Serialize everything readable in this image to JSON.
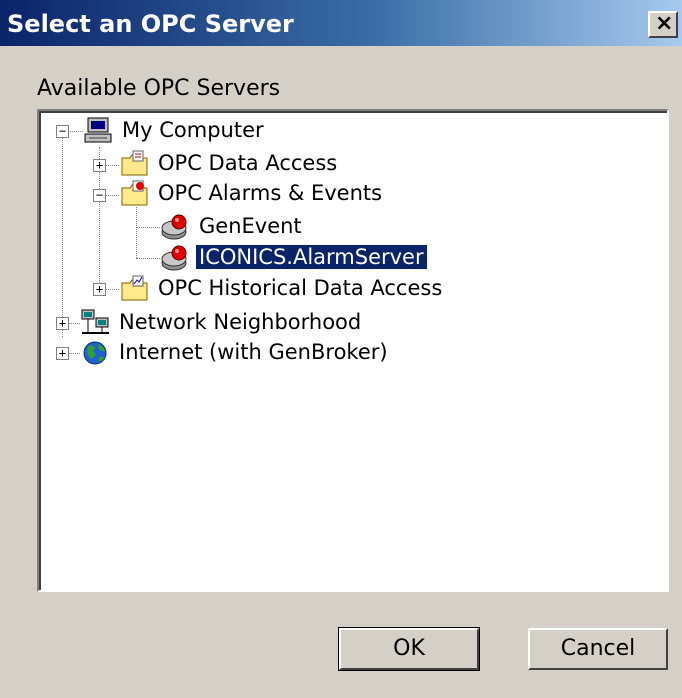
{
  "window": {
    "title": "Select an OPC Server",
    "close_glyph": "×"
  },
  "group_label": "Available OPC Servers",
  "tree": {
    "nodes": [
      {
        "label": "My Computer",
        "icon": "computer-icon",
        "expander": "minus"
      },
      {
        "label": "OPC Data Access",
        "icon": "folder-icon",
        "expander": "plus"
      },
      {
        "label": "OPC Alarms & Events",
        "icon": "folder-icon",
        "expander": "minus"
      },
      {
        "label": "GenEvent",
        "icon": "alarm-server-icon",
        "expander": "none"
      },
      {
        "label": "ICONICS.AlarmServer",
        "icon": "alarm-server-icon",
        "expander": "none",
        "selected": true
      },
      {
        "label": "OPC Historical Data Access",
        "icon": "folder-icon",
        "expander": "plus"
      },
      {
        "label": "Network Neighborhood",
        "icon": "network-icon",
        "expander": "plus"
      },
      {
        "label": "Internet (with GenBroker)",
        "icon": "globe-icon",
        "expander": "plus"
      }
    ]
  },
  "buttons": {
    "ok_label": "OK",
    "cancel_label": "Cancel"
  },
  "colors": {
    "title_start": "#0a246a",
    "title_end": "#a6caf0",
    "selection": "#0a246a",
    "face": "#d4d0c8"
  }
}
